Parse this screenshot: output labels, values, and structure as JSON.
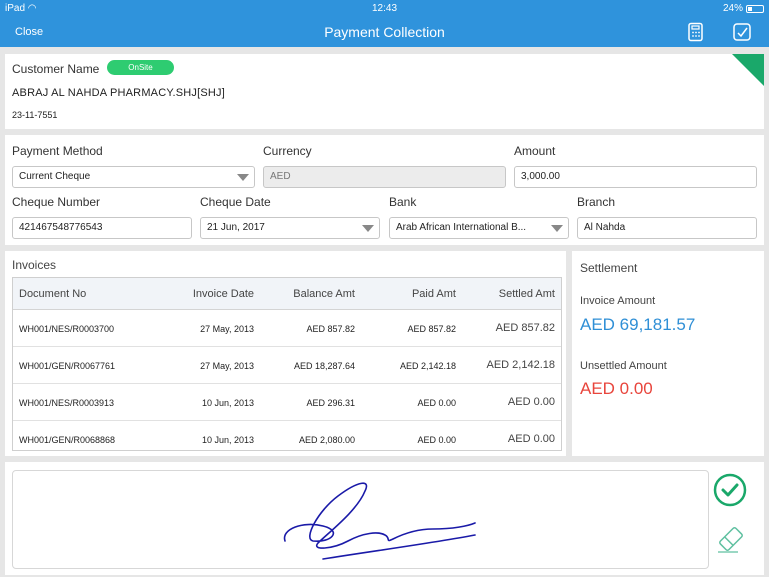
{
  "status_bar": {
    "device": "iPad",
    "time": "12:43",
    "battery": "24%"
  },
  "nav": {
    "close_label": "Close",
    "title": "Payment Collection",
    "icons": [
      "calculator-icon",
      "checklist-icon"
    ]
  },
  "customer": {
    "label": "Customer Name",
    "badge": "OnSite",
    "name": "ABRAJ AL NAHDA PHARMACY.SHJ[SHJ]",
    "code": "23-11-7551"
  },
  "payment": {
    "method_label": "Payment Method",
    "method_value": "Current Cheque",
    "currency_label": "Currency",
    "currency_value": "AED",
    "amount_label": "Amount",
    "amount_value": "3,000.00",
    "cheque_number_label": "Cheque Number",
    "cheque_number_value": "421467548776543",
    "cheque_date_label": "Cheque Date",
    "cheque_date_value": "21 Jun, 2017",
    "bank_label": "Bank",
    "bank_value": "Arab African International B...",
    "branch_label": "Branch",
    "branch_value": "Al Nahda"
  },
  "invoices": {
    "title": "Invoices",
    "headers": [
      "Document No",
      "Invoice Date",
      "Balance Amt",
      "Paid Amt",
      "Settled Amt"
    ],
    "rows": [
      [
        "WH001/NES/R0003700",
        "27 May, 2013",
        "AED 857.82",
        "AED 857.82",
        "AED 857.82"
      ],
      [
        "WH001/GEN/R0067761",
        "27 May, 2013",
        "AED 18,287.64",
        "AED 2,142.18",
        "AED 2,142.18"
      ],
      [
        "WH001/NES/R0003913",
        "10 Jun, 2013",
        "AED 296.31",
        "AED 0.00",
        "AED 0.00"
      ],
      [
        "WH001/GEN/R0068868",
        "10 Jun, 2013",
        "AED 2,080.00",
        "AED 0.00",
        "AED 0.00"
      ]
    ]
  },
  "settlement": {
    "title": "Settlement",
    "invoice_amount_label": "Invoice Amount",
    "invoice_amount_value": "AED 69,181.57",
    "unsettled_label": "Unsettled Amount",
    "unsettled_value": "AED 0.00"
  },
  "colors": {
    "primary": "#2f93dc",
    "onsite": "#2ecc71",
    "accent_green": "#1aa86a",
    "value_blue": "#2f8fd6",
    "value_red": "#e8453c",
    "signature": "#1a1aa8"
  }
}
